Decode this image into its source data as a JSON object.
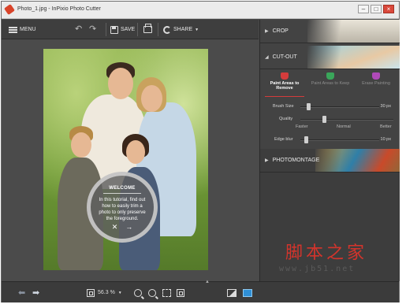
{
  "window": {
    "title": "Photo_1.jpg - InPixio Photo Cutter"
  },
  "toolbar": {
    "menu_label": "MENU",
    "save_label": "SAVE",
    "share_label": "SHARE"
  },
  "tutorial": {
    "title": "WELCOME",
    "body": "In this tutorial, find out how to easily trim a photo to only preserve the foreground."
  },
  "panel": {
    "crop_label": "CROP",
    "cutout_label": "CUT-OUT",
    "photomontage_label": "PHOTOMONTAGE",
    "tools": [
      {
        "label": "Paint Areas to Remove",
        "active": true,
        "color": "#d43c3c"
      },
      {
        "label": "Paint Areas to Keep",
        "active": false,
        "color": "#3aa65a"
      },
      {
        "label": "Erase Painting",
        "active": false,
        "color": "#b04ab8"
      }
    ],
    "brush_size": {
      "label": "Brush Size",
      "value": "30 px",
      "level": 0.1
    },
    "quality": {
      "label": "Quality",
      "options": [
        "Faster",
        "Normal",
        "Better"
      ],
      "level": 0.25
    },
    "edge_blur": {
      "label": "Edge blur",
      "value": "10 px",
      "level": 0.07
    }
  },
  "bottombar": {
    "zoom": "56.3 %"
  },
  "watermark": {
    "cn": "脚本之家",
    "url": "www.jb51.net"
  },
  "colors": {
    "accent": "#d43c3c",
    "panel_toggle": "#2f8fd6"
  }
}
